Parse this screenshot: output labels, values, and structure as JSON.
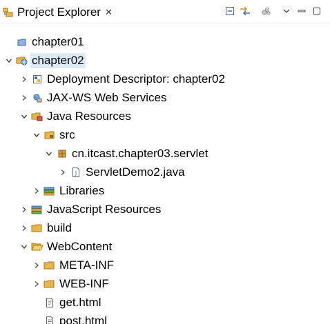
{
  "view": {
    "title": "Project Explorer",
    "close_glyph": "✕",
    "toolbar": [
      {
        "name": "collapse-all-icon"
      },
      {
        "name": "link-with-editor-icon"
      },
      {
        "name": "filter-icon"
      },
      {
        "name": "view-menu-icon"
      },
      {
        "name": "minimize-icon"
      },
      {
        "name": "maximize-icon"
      }
    ]
  },
  "tree": {
    "items": [
      {
        "label": "chapter01",
        "icon": "closed-project-icon",
        "expanded": null
      },
      {
        "label": "chapter02",
        "icon": "web-project-icon",
        "expanded": true,
        "selected": true
      },
      {
        "label": "Deployment Descriptor: chapter02",
        "icon": "deployment-descriptor-icon",
        "expanded": false
      },
      {
        "label": "JAX-WS Web Services",
        "icon": "web-services-icon",
        "expanded": false
      },
      {
        "label": "Java Resources",
        "icon": "java-resources-icon",
        "expanded": true
      },
      {
        "label": "src",
        "icon": "source-folder-icon",
        "expanded": true
      },
      {
        "label": "cn.itcast.chapter03.servlet",
        "icon": "package-icon",
        "expanded": true
      },
      {
        "label": "ServletDemo2.java",
        "icon": "java-file-icon",
        "expanded": false
      },
      {
        "label": "Libraries",
        "icon": "libraries-icon",
        "expanded": false
      },
      {
        "label": "JavaScript Resources",
        "icon": "javascript-resources-icon",
        "expanded": false
      },
      {
        "label": "build",
        "icon": "folder-icon",
        "expanded": false
      },
      {
        "label": "WebContent",
        "icon": "folder-open-icon",
        "expanded": true
      },
      {
        "label": "META-INF",
        "icon": "folder-icon",
        "expanded": false
      },
      {
        "label": "WEB-INF",
        "icon": "folder-icon",
        "expanded": false
      },
      {
        "label": "get.html",
        "icon": "html-file-icon",
        "expanded": null
      },
      {
        "label": "post.html",
        "icon": "html-file-icon",
        "expanded": null
      }
    ]
  },
  "colors": {
    "selection": "#dcebfb",
    "folder": "#e8b64c",
    "arrow": "#555555"
  }
}
